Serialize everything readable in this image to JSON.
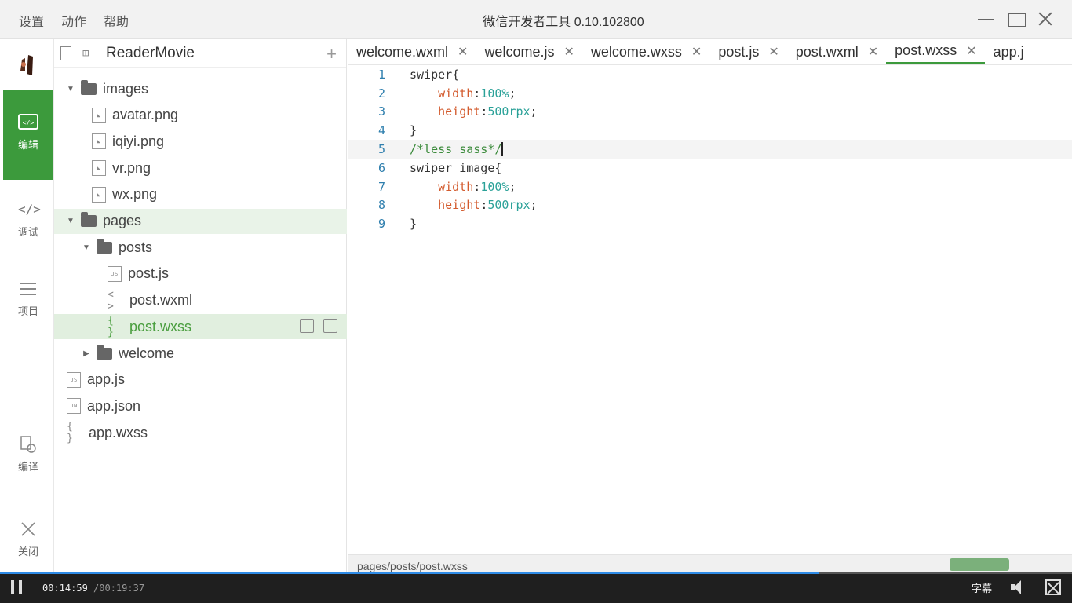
{
  "menu": [
    "设置",
    "动作",
    "帮助"
  ],
  "window_title": "微信开发者工具 0.10.102800",
  "rail": {
    "items": [
      {
        "label": "编辑",
        "icon": "code-window-icon"
      },
      {
        "label": "调试",
        "icon": "code-tags-icon"
      },
      {
        "label": "项目",
        "icon": "list-icon"
      },
      {
        "label": "编译",
        "icon": "compile-icon"
      },
      {
        "label": "关闭",
        "icon": "close-icon"
      }
    ]
  },
  "tree": {
    "project": "ReaderMovie",
    "rows": [
      {
        "name": "images",
        "type": "folder",
        "open": true
      },
      {
        "name": "avatar.png",
        "type": "image"
      },
      {
        "name": "iqiyi.png",
        "type": "image"
      },
      {
        "name": "vr.png",
        "type": "image"
      },
      {
        "name": "wx.png",
        "type": "image"
      },
      {
        "name": "pages",
        "type": "folder",
        "open": true
      },
      {
        "name": "posts",
        "type": "folder",
        "open": true
      },
      {
        "name": "post.js",
        "type": "js"
      },
      {
        "name": "post.wxml",
        "type": "wxml"
      },
      {
        "name": "post.wxss",
        "type": "wxss",
        "selected": true
      },
      {
        "name": "welcome",
        "type": "folder",
        "open": false
      },
      {
        "name": "app.js",
        "type": "js"
      },
      {
        "name": "app.json",
        "type": "json"
      },
      {
        "name": "app.wxss",
        "type": "wxss"
      }
    ],
    "icon_labels": {
      "js": "JS",
      "json": "JN",
      "image": "◣"
    }
  },
  "tabs": [
    {
      "label": "welcome.wxml"
    },
    {
      "label": "welcome.js"
    },
    {
      "label": "welcome.wxss"
    },
    {
      "label": "post.js"
    },
    {
      "label": "post.wxml"
    },
    {
      "label": "post.wxss",
      "active": true
    },
    {
      "label": "app.j"
    }
  ],
  "code": {
    "lines": [
      {
        "n": "1",
        "sel": "swiper{"
      },
      {
        "n": "2",
        "prop": "width",
        "val": "100%"
      },
      {
        "n": "3",
        "prop": "height",
        "val": "500rpx"
      },
      {
        "n": "4",
        "sel": "}"
      },
      {
        "n": "5",
        "comment": "/*less sass*/",
        "current": true
      },
      {
        "n": "6",
        "sel": "swiper image{"
      },
      {
        "n": "7",
        "prop": "width",
        "val": "100%"
      },
      {
        "n": "8",
        "prop": "height",
        "val": "500rpx"
      },
      {
        "n": "9",
        "sel": "}"
      }
    ]
  },
  "status": {
    "path": "pages/posts/post.wxss"
  },
  "player": {
    "current": "00:14:59",
    "total": "/00:19:37",
    "progress": 0.764,
    "subtitle_label": "字幕"
  },
  "colors": {
    "accent": "#3c9a3c",
    "progress": "#2e8be6"
  }
}
